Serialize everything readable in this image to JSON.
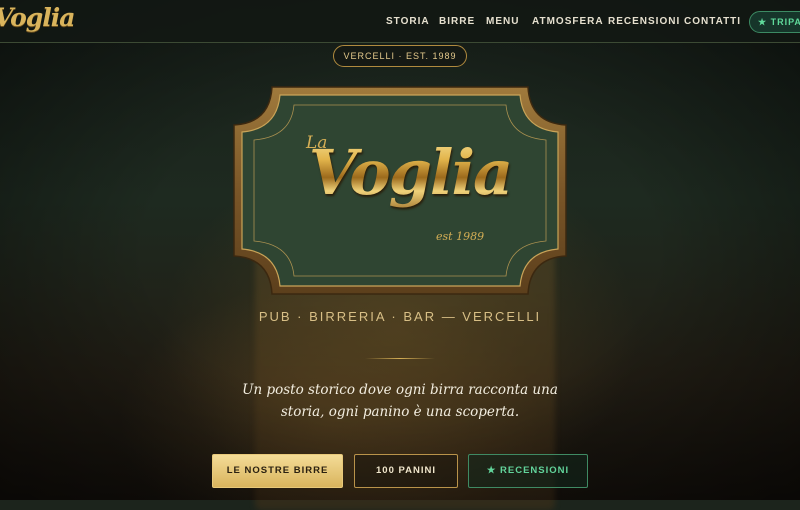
{
  "brand": {
    "logo_text": "Voglia",
    "colors": {
      "gold": "#d4ae55",
      "green_panel": "#2f4532",
      "accent_green": "#5fd99a"
    }
  },
  "nav": {
    "items": [
      {
        "label": "STORIA"
      },
      {
        "label": "BIRRE"
      },
      {
        "label": "MENU"
      },
      {
        "label": "ATMOSFERA"
      },
      {
        "label": "RECENSIONI"
      },
      {
        "label": "CONTATTI"
      }
    ],
    "tripadvisor": {
      "icon": "star-icon",
      "label": "★ TRIPADVISOR"
    }
  },
  "hero": {
    "badge": "VERCELLI · EST. 1989",
    "sign": {
      "la": "La",
      "name": "Voglia",
      "est": "est 1989"
    },
    "tagline": "PUB · BIRRERIA · BAR — VERCELLI",
    "intro": "Un posto storico dove ogni birra racconta una storia, ogni panino è una scoperta."
  },
  "cta": {
    "primary": "LE NOSTRE BIRRE",
    "secondary": "100 PANINI",
    "reviews": "★ RECENSIONI"
  }
}
